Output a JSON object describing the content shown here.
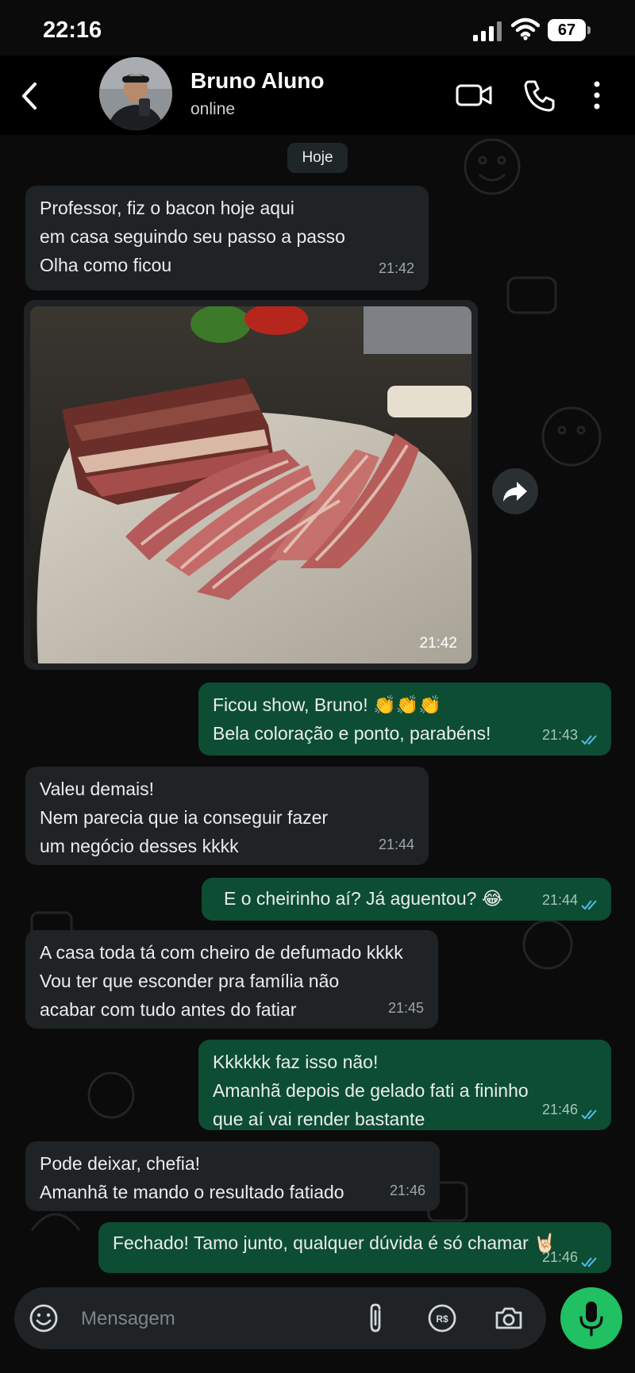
{
  "status_bar": {
    "time": "22:16",
    "battery": "67"
  },
  "header": {
    "contact_name": "Bruno Aluno",
    "contact_status": "online"
  },
  "date_separator": "Hoje",
  "messages": [
    {
      "direction": "incoming",
      "text": "Professor, fiz o bacon hoje aqui\nem casa seguindo seu passo a passo\nOlha como ficou",
      "time": "21:42"
    },
    {
      "direction": "incoming",
      "type": "image",
      "caption": "",
      "time": "21:42"
    },
    {
      "direction": "outgoing",
      "text": "Ficou show, Bruno! 👏👏👏\nBela coloração e ponto, parabéns!",
      "time": "21:43",
      "status": "read"
    },
    {
      "direction": "incoming",
      "text": "Valeu demais!\nNem parecia que ia conseguir fazer\num negócio desses kkkk",
      "time": "21:44"
    },
    {
      "direction": "outgoing",
      "text": "E o cheirinho aí? Já aguentou? 😂",
      "time": "21:44",
      "status": "read"
    },
    {
      "direction": "incoming",
      "text": "A casa toda tá com cheiro de defumado kkkk\nVou ter que esconder pra família não\nacabar com tudo antes do fatiar",
      "time": "21:45"
    },
    {
      "direction": "outgoing",
      "text": "Kkkkkk faz isso não!\nAmanhã depois de gelado fati a fininho\nque aí vai render bastante",
      "time": "21:46",
      "status": "read"
    },
    {
      "direction": "incoming",
      "text": "Pode deixar, chefia!\nAmanhã te mando o resultado fatiado",
      "time": "21:46"
    },
    {
      "direction": "outgoing",
      "text": "Fechado! Tamo junto, qualquer dúvida é só chamar 🤘🏻",
      "time": "21:46",
      "status": "read"
    }
  ],
  "composer": {
    "placeholder": "Mensagem"
  },
  "colors": {
    "incoming_bubble": "#1f2326",
    "outgoing_bubble": "#0d4d33",
    "read_ticks": "#53bdeb",
    "mic_button": "#21c063"
  },
  "icons": [
    "back-arrow-icon",
    "video-camera-icon",
    "phone-icon",
    "more-vertical-icon",
    "forward-icon",
    "emoji-icon",
    "paperclip-icon",
    "payment-icon",
    "camera-icon",
    "microphone-icon"
  ]
}
